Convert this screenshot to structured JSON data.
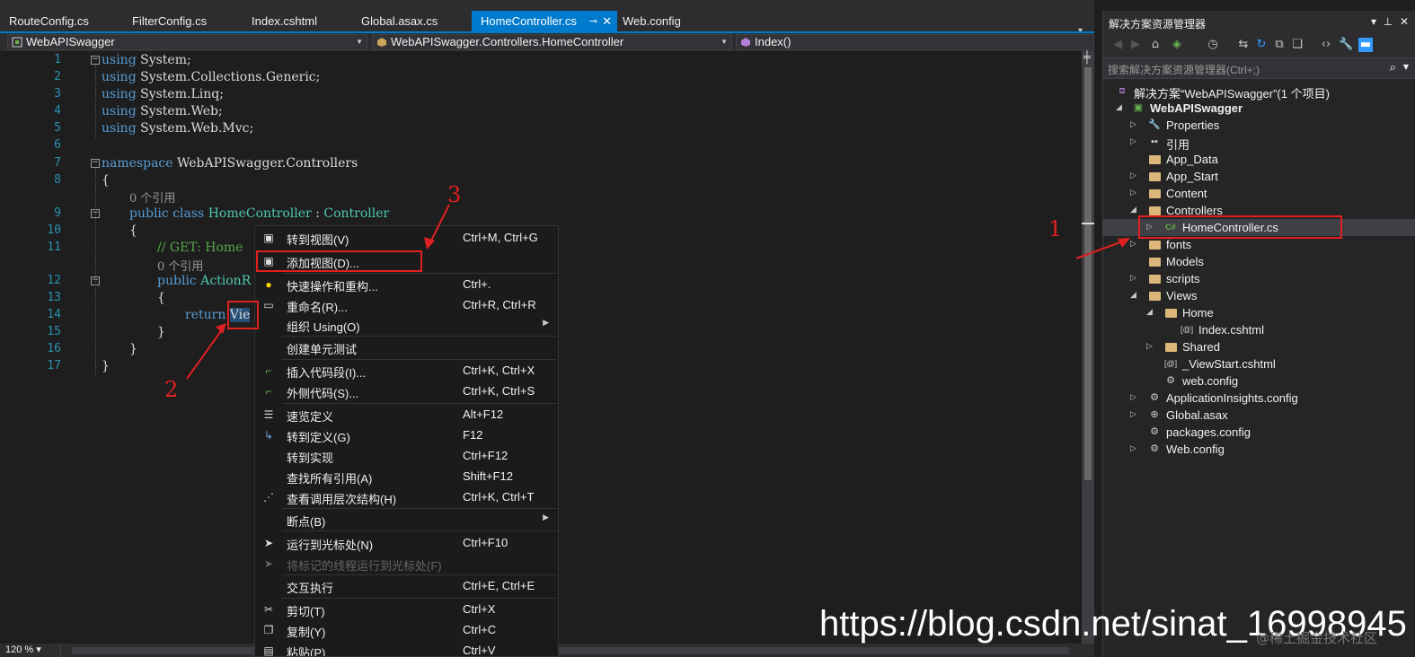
{
  "tabs": [
    {
      "label": "RouteConfig.cs"
    },
    {
      "label": "FilterConfig.cs"
    },
    {
      "label": "Index.cshtml"
    },
    {
      "label": "Global.asax.cs"
    },
    {
      "label": "HomeController.cs",
      "active": true
    },
    {
      "label": "Web.config"
    }
  ],
  "nav": {
    "project": "WebAPISwagger",
    "type": "WebAPISwagger.Controllers.HomeController",
    "member": "Index()"
  },
  "editor": {
    "line_numbers": [
      "1",
      "2",
      "3",
      "4",
      "5",
      "6",
      "7",
      "8",
      "9",
      "10",
      "11",
      "12",
      "13",
      "14",
      "15",
      "16",
      "17"
    ],
    "using1": "System;",
    "using2": "System.Collections.Generic;",
    "using3": "System.Linq;",
    "using4": "System.Web;",
    "using5": "System.Web.Mvc;",
    "kw_using": "using",
    "kw_namespace": "namespace",
    "namespace_name": "WebAPISwagger.Controllers",
    "open_brace": "{",
    "close_brace": "}",
    "ref_count": "0 个引用",
    "kw_public": "public",
    "kw_class": "class",
    "class_name": "HomeController :",
    "base_class": "Controller",
    "comment": "// GET: Home",
    "method_visible": "ActionR",
    "kw_return": "return",
    "selected_text": "Vie",
    "zoom": "120 %"
  },
  "context_menu": {
    "items": [
      {
        "label": "转到视图(V)",
        "shortcut": "Ctrl+M, Ctrl+G",
        "icon": "view-icon"
      },
      {
        "label": "添加视图(D)...",
        "shortcut": "",
        "icon": "add-view-icon"
      },
      {
        "label": "快速操作和重构...",
        "shortcut": "Ctrl+.",
        "icon": "lightbulb-icon"
      },
      {
        "label": "重命名(R)...",
        "shortcut": "Ctrl+R, Ctrl+R",
        "icon": "rename-icon"
      },
      {
        "label": "组织 Using(O)",
        "shortcut": "",
        "icon": "",
        "submenu": true
      },
      {
        "label": "创建单元测试",
        "shortcut": "",
        "icon": ""
      },
      {
        "label": "插入代码段(I)...",
        "shortcut": "Ctrl+K, Ctrl+X",
        "icon": "snippet-icon"
      },
      {
        "label": "外侧代码(S)...",
        "shortcut": "Ctrl+K, Ctrl+S",
        "icon": "surround-icon"
      },
      {
        "label": "速览定义",
        "shortcut": "Alt+F12",
        "icon": "peek-icon"
      },
      {
        "label": "转到定义(G)",
        "shortcut": "F12",
        "icon": "goto-definition-icon"
      },
      {
        "label": "转到实现",
        "shortcut": "Ctrl+F12",
        "icon": ""
      },
      {
        "label": "查找所有引用(A)",
        "shortcut": "Shift+F12",
        "icon": ""
      },
      {
        "label": "查看调用层次结构(H)",
        "shortcut": "Ctrl+K, Ctrl+T",
        "icon": "call-hierarchy-icon"
      },
      {
        "label": "断点(B)",
        "shortcut": "",
        "icon": "",
        "submenu": true
      },
      {
        "label": "运行到光标处(N)",
        "shortcut": "Ctrl+F10",
        "icon": "cursor-icon"
      },
      {
        "label": "将标记的线程运行到光标处(F)",
        "shortcut": "",
        "icon": "cursor-icon",
        "disabled": true
      },
      {
        "label": "交互执行",
        "shortcut": "Ctrl+E, Ctrl+E",
        "icon": ""
      },
      {
        "label": "剪切(T)",
        "shortcut": "Ctrl+X",
        "icon": "scissors-icon"
      },
      {
        "label": "复制(Y)",
        "shortcut": "Ctrl+C",
        "icon": "copy-icon"
      },
      {
        "label": "粘贴(P)",
        "shortcut": "Ctrl+V",
        "icon": "paste-icon"
      }
    ]
  },
  "annotations": {
    "n1": "1",
    "n2": "2",
    "n3": "3"
  },
  "solution_explorer": {
    "title": "解决方案资源管理器",
    "search_placeholder": "搜索解决方案资源管理器(Ctrl+;)",
    "tree": [
      {
        "label": "解决方案“WebAPISwagger”(1 个项目)",
        "icon": "solution-icon"
      },
      {
        "label": "WebAPISwagger",
        "icon": "project-icon"
      },
      {
        "label": "Properties",
        "icon": "wrench-icon"
      },
      {
        "label": "引用",
        "icon": "references-icon"
      },
      {
        "label": "App_Data",
        "icon": "folder-icon"
      },
      {
        "label": "App_Start",
        "icon": "folder-icon"
      },
      {
        "label": "Content",
        "icon": "folder-icon"
      },
      {
        "label": "Controllers",
        "icon": "folder-open-icon"
      },
      {
        "label": "HomeController.cs",
        "icon": "csharp-file-icon"
      },
      {
        "label": "fonts",
        "icon": "folder-icon"
      },
      {
        "label": "Models",
        "icon": "folder-icon"
      },
      {
        "label": "scripts",
        "icon": "folder-icon"
      },
      {
        "label": "Views",
        "icon": "folder-open-icon"
      },
      {
        "label": "Home",
        "icon": "folder-open-icon"
      },
      {
        "label": "Index.cshtml",
        "icon": "razor-file-icon"
      },
      {
        "label": "Shared",
        "icon": "folder-icon"
      },
      {
        "label": "_ViewStart.cshtml",
        "icon": "razor-file-icon"
      },
      {
        "label": "web.config",
        "icon": "config-file-icon"
      },
      {
        "label": "ApplicationInsights.config",
        "icon": "config-file-icon"
      },
      {
        "label": "Global.asax",
        "icon": "global-icon"
      },
      {
        "label": "packages.config",
        "icon": "config-file-icon"
      },
      {
        "label": "Web.config",
        "icon": "config-file-icon"
      }
    ]
  },
  "watermark": "https://blog.csdn.net/sinat_16998945",
  "watermark2": "@稀土掘金技术社区",
  "colors": {
    "accent": "#007acc",
    "annotation": "#e02020",
    "keyword": "#569cd6",
    "type": "#4ec9b0",
    "comment": "#57a64a",
    "linenumber": "#2b91af"
  }
}
